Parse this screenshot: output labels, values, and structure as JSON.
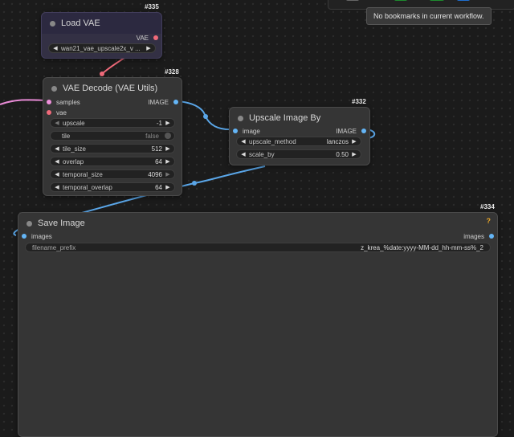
{
  "toolbar": {
    "icons": [
      "grid-icon",
      "cpu-icon",
      "ram-icon",
      "gpu-icon"
    ],
    "accent_green": "#1e8c2e",
    "accent_blue": "#1f6fd1"
  },
  "tooltip": {
    "text": "No bookmarks in current workflow."
  },
  "colors": {
    "link_blue": "#5aa6e8",
    "link_pink": "#e88bd6",
    "slot_vae_red": "#f06a7a",
    "slot_samples_pink": "#ee8fda",
    "slot_image_blue": "#64b5f6"
  },
  "nodes": {
    "load_vae": {
      "id": "#335",
      "title": "Load VAE",
      "output": "VAE",
      "vae_name": "wan21_vae_upscale2x_v ..."
    },
    "vae_decode": {
      "id": "#328",
      "title": "VAE Decode (VAE Utils)",
      "inputs": [
        "samples",
        "vae"
      ],
      "output": "IMAGE",
      "widgets": [
        {
          "label": "upscale",
          "value": "-1"
        },
        {
          "label": "tile",
          "value": "false"
        },
        {
          "label": "tile_size",
          "value": "512"
        },
        {
          "label": "overlap",
          "value": "64"
        },
        {
          "label": "temporal_size",
          "value": "4096"
        },
        {
          "label": "temporal_overlap",
          "value": "64"
        }
      ]
    },
    "upscale_image_by": {
      "id": "#332",
      "title": "Upscale Image By",
      "input": "image",
      "output": "IMAGE",
      "widgets": [
        {
          "label": "upscale_method",
          "value": "lanczos"
        },
        {
          "label": "scale_by",
          "value": "0.50"
        }
      ]
    },
    "save_image": {
      "id": "#334",
      "title": "Save Image",
      "input": "images",
      "output": "images",
      "help": "?",
      "filename_prefix_label": "filename_prefix",
      "filename_prefix_value": "z_krea_%date:yyyy-MM-dd_hh-mm-ss%_2"
    }
  }
}
